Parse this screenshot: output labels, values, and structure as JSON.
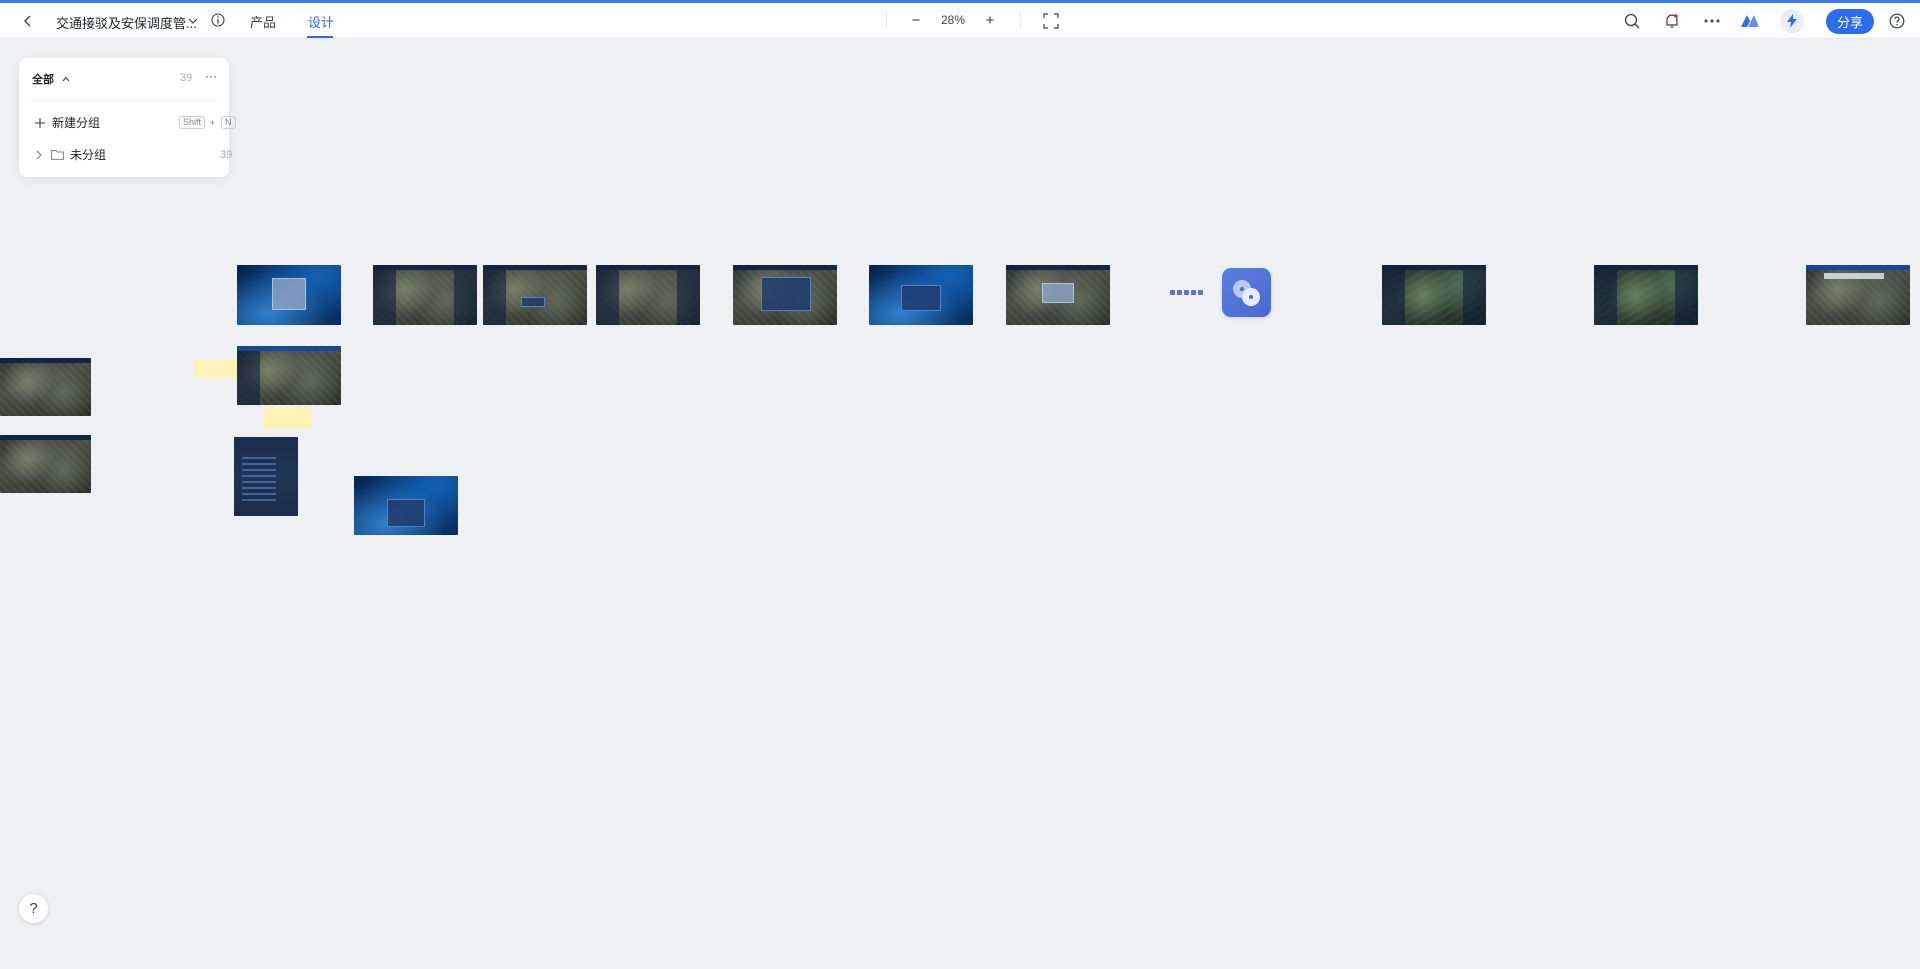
{
  "header": {
    "doc_title": "交通接驳及安保调度管...",
    "tabs": [
      {
        "label": "产品",
        "active": false
      },
      {
        "label": "设计",
        "active": true
      }
    ],
    "zoom_minus": "−",
    "zoom_level": "28%",
    "zoom_plus": "+",
    "share_label": "分享"
  },
  "page_panel": {
    "title": "全部",
    "total_count": "39",
    "more": "···",
    "new_group_label": "新建分组",
    "shortcut_key1": "Shift",
    "shortcut_plus": "+",
    "shortcut_key2": "N",
    "ungrouped_label": "未分组",
    "ungrouped_count": "39"
  },
  "help_label": "?",
  "colors": {
    "accent": "#2b6cf0",
    "topline": "#3d7cf0",
    "canvas_bg": "#eef0f4",
    "app_icon": "#4a68d2"
  },
  "icons": {
    "back": "chevron-left-icon",
    "title_dropdown": "chevron-down-icon",
    "info": "info-icon",
    "fullscreen": "fullscreen-icon",
    "search": "search-icon",
    "notifications": "bell-icon",
    "more": "more-icon",
    "brand": "brand-logo-icon",
    "ai": "lightning-icon",
    "help": "help-icon"
  }
}
